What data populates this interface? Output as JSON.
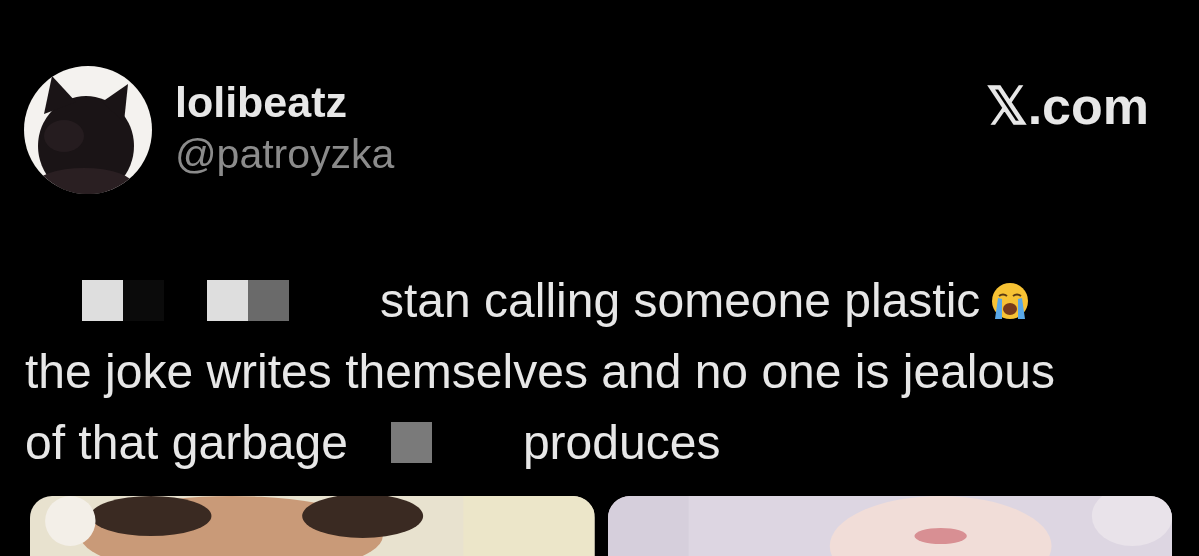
{
  "author": {
    "name": "lolibeatz",
    "handle": "@patroyzka"
  },
  "source": "𝕏.com",
  "body": {
    "lines": [
      {
        "segments": [
          {
            "kind": "censor",
            "cells": [
              {
                "color": "#dedede"
              },
              {
                "color": "#0b0b0b"
              }
            ]
          },
          {
            "kind": "censor",
            "cells": [
              {
                "color": "#dedede"
              },
              {
                "color": "#6a6a6a"
              }
            ]
          },
          {
            "kind": "text",
            "text": "stan calling someone plastic"
          },
          {
            "kind": "emoji"
          }
        ]
      },
      {
        "segments": [
          {
            "kind": "text",
            "text": "the joke writes themselves and no one is jealous"
          }
        ]
      },
      {
        "segments": [
          {
            "kind": "text",
            "text": "of that garbage"
          },
          {
            "kind": "censor",
            "cells": [
              {
                "color": "#7a7a7a"
              }
            ]
          },
          {
            "kind": "text",
            "text": "produces"
          }
        ]
      }
    ]
  }
}
